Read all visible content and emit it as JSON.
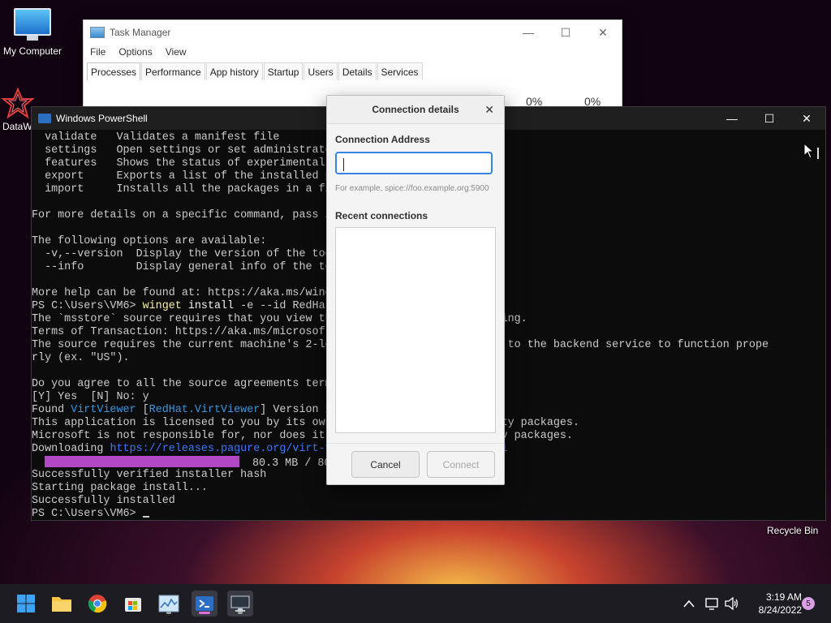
{
  "desktop": {
    "icons": [
      {
        "label": "My Computer"
      },
      {
        "label": "DataW"
      }
    ],
    "recycle_bin": "Recycle Bin"
  },
  "task_manager": {
    "title": "Task Manager",
    "menu": [
      "File",
      "Options",
      "View"
    ],
    "tabs": [
      "Processes",
      "Performance",
      "App history",
      "Startup",
      "Users",
      "Details",
      "Services"
    ],
    "active_tab": "Processes",
    "percent_1": "0%",
    "percent_2": "0%"
  },
  "powershell": {
    "title": "Windows PowerShell",
    "lines": [
      "  validate   Validates a manifest file",
      "  settings   Open settings or set administrato",
      "  features   Shows the status of experimental ",
      "  export     Exports a list of the installed p",
      "  import     Installs all the packages in a fi",
      "",
      "For more details on a specific command, pass i",
      "",
      "The following options are available:",
      "  -v,--version  Display the version of the too",
      "  --info        Display general info of the to",
      "",
      "More help can be found at: https://aka.ms/wing",
      "PS C:\\Users\\VM6> winget install -e --id RedHat",
      "The `msstore` source requires that you view th                    ore using.",
      "Terms of Transaction: https://aka.ms/microsof",
      "The source requires the current machine's 2-le                    e sent to the backend service to function prope",
      "rly (ex. \"US\").",
      "",
      "Do you agree to all the source agreements term",
      "[Y] Yes  [N] No: y",
      "Found VirtViewer [RedHat.VirtViewer] Version 1",
      "This application is licensed to you by its own                    rd-party packages.",
      "Microsoft is not responsible for, nor does it                    rd-party packages.",
      "Downloading https://releases.pagure.org/virt-v                    1.0.msi",
      "PROGRESS",
      "Successfully verified installer hash",
      "Starting package install...",
      "Successfully installed",
      "PS C:\\Users\\VM6> "
    ],
    "progress_text": "80.3 MB / 80",
    "progress_fraction": 1.0
  },
  "dialog": {
    "title": "Connection details",
    "address_label": "Connection Address",
    "address_value": "",
    "hint": "For example, spice://foo.example.org:5900",
    "recent_label": "Recent connections",
    "cancel_label": "Cancel",
    "connect_label": "Connect"
  },
  "taskbar": {
    "time": "3:19 AM",
    "date": "8/24/2022",
    "notification_count": "5"
  },
  "colors": {
    "accent": "#3584e4",
    "progress": "#b148c6",
    "terminal_bg": "#0c0c0c"
  }
}
